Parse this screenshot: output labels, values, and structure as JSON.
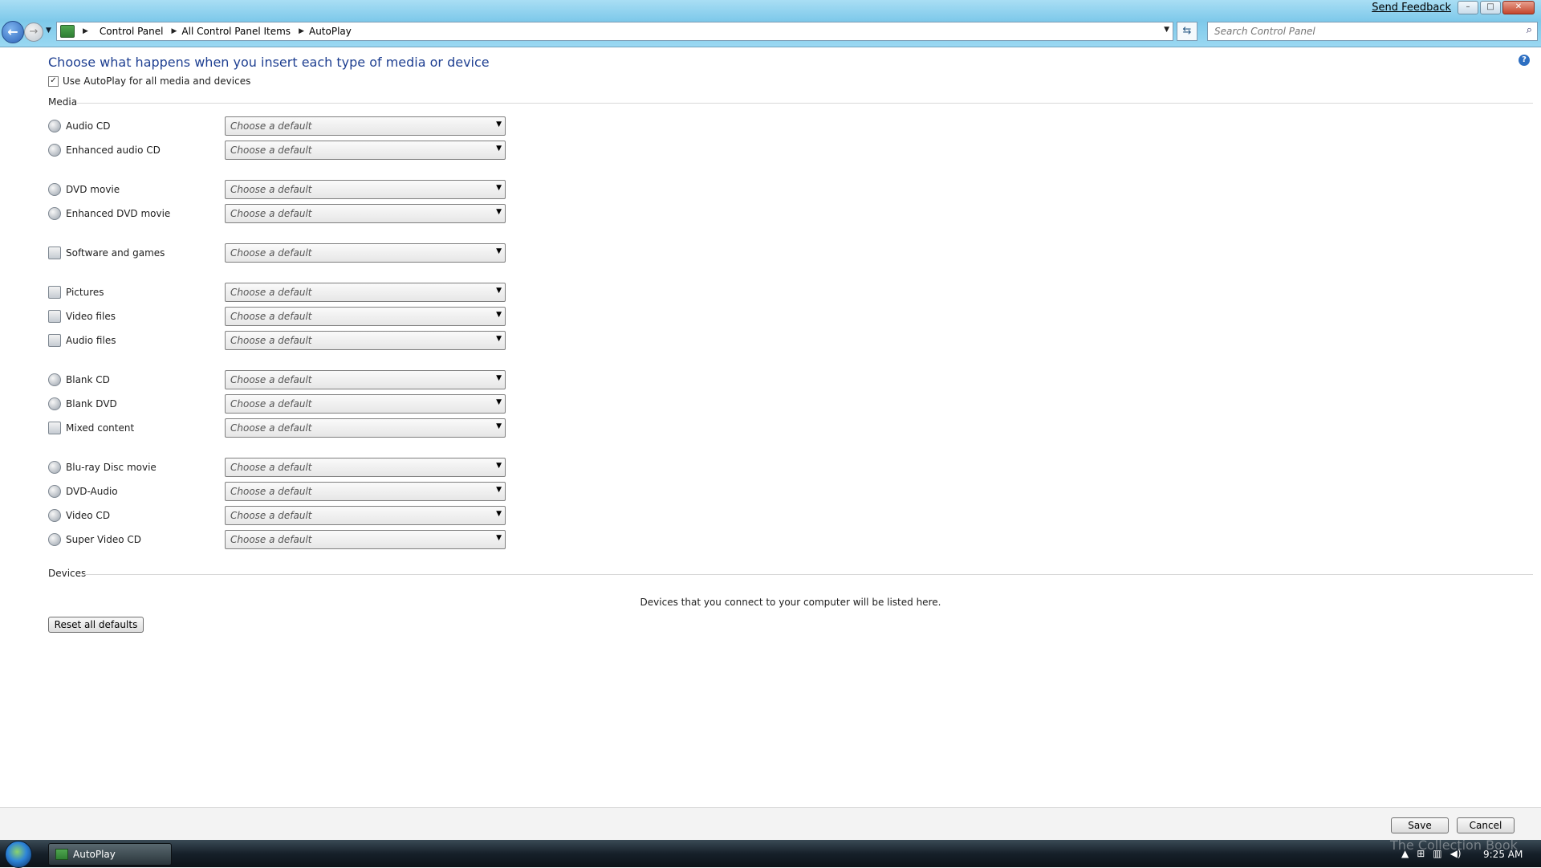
{
  "window": {
    "send_feedback": "Send Feedback",
    "minimize": "–",
    "restore": "□",
    "close": "✕"
  },
  "nav": {
    "back_glyph": "←",
    "forward_glyph": "→",
    "breadcrumbs": [
      "Control Panel",
      "All Control Panel Items",
      "AutoPlay"
    ],
    "search_placeholder": "Search Control Panel"
  },
  "page": {
    "heading": "Choose what happens when you insert each type of media or device",
    "autoplay_checkbox_label": "Use AutoPlay for all media and devices",
    "autoplay_checked": true,
    "media_section": "Media",
    "devices_section": "Devices",
    "devices_message": "Devices that you connect to your computer will be listed here.",
    "reset_button": "Reset all defaults",
    "help_glyph": "?"
  },
  "media_items": [
    {
      "label": "Audio CD",
      "value": "Choose a default"
    },
    {
      "label": "Enhanced audio CD",
      "value": "Choose a default"
    },
    {
      "label": "DVD movie",
      "value": "Choose a default"
    },
    {
      "label": "Enhanced DVD movie",
      "value": "Choose a default"
    },
    {
      "label": "Software and games",
      "value": "Choose a default"
    },
    {
      "label": "Pictures",
      "value": "Choose a default"
    },
    {
      "label": "Video files",
      "value": "Choose a default"
    },
    {
      "label": "Audio files",
      "value": "Choose a default"
    },
    {
      "label": "Blank CD",
      "value": "Choose a default"
    },
    {
      "label": "Blank DVD",
      "value": "Choose a default"
    },
    {
      "label": "Mixed content",
      "value": "Choose a default"
    },
    {
      "label": "Blu-ray Disc movie",
      "value": "Choose a default"
    },
    {
      "label": "DVD-Audio",
      "value": "Choose a default"
    },
    {
      "label": "Video CD",
      "value": "Choose a default"
    },
    {
      "label": "Super Video CD",
      "value": "Choose a default"
    }
  ],
  "footer": {
    "save": "Save",
    "cancel": "Cancel"
  },
  "taskbar": {
    "app_label": "AutoPlay",
    "clock": "9:25 AM",
    "watermark": "The Collection Book"
  }
}
